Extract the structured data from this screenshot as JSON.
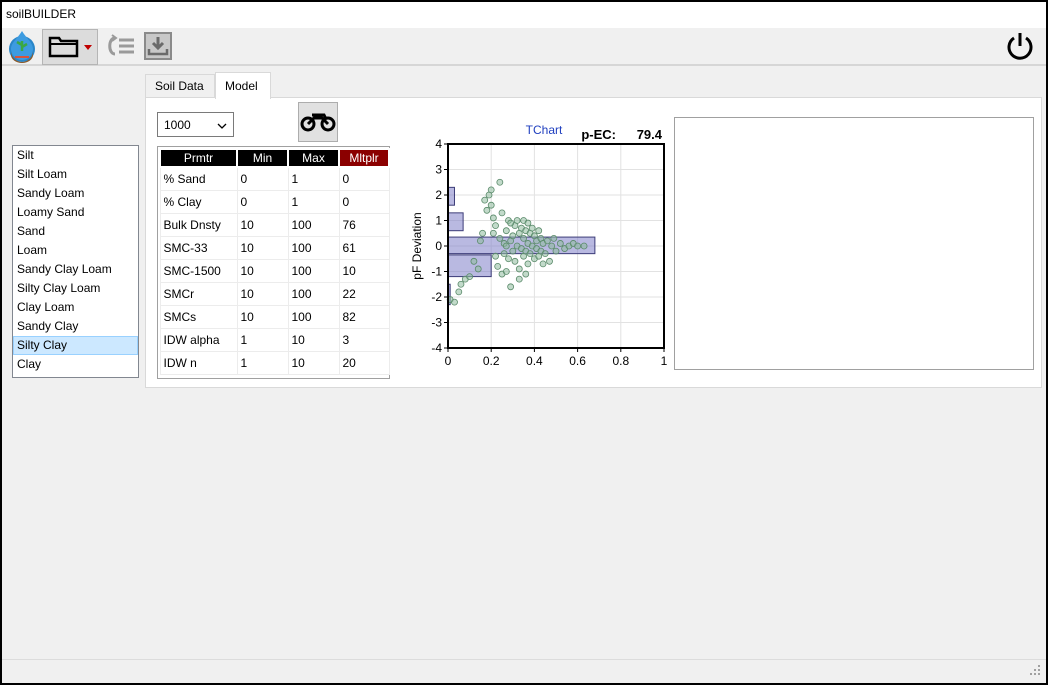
{
  "window": {
    "title": "soilBUILDER"
  },
  "toolbar": {
    "logo_icon": "soilbuilder-logo-icon",
    "open_icon": "folder-icon",
    "undo_icon": "undo-list-icon",
    "save_icon": "save-download-icon",
    "power_icon": "power-icon"
  },
  "soil_list": {
    "items": [
      "Silt",
      "Silt Loam",
      "Sandy Loam",
      "Loamy Sand",
      "Sand",
      "Loam",
      "Sandy Clay Loam",
      "Silty Clay Loam",
      "Clay Loam",
      "Sandy Clay",
      "Silty Clay",
      "Clay"
    ],
    "selected": "Silty Clay"
  },
  "tabs": [
    {
      "label": "Soil Data",
      "active": false
    },
    {
      "label": "Model",
      "active": true
    }
  ],
  "model": {
    "iterations_value": "1000",
    "run_icon": "motorcycle-icon",
    "grid": {
      "headers": [
        "Prmtr",
        "Min",
        "Max",
        "Mltplr"
      ],
      "rows": [
        [
          "% Sand",
          "0",
          "1",
          "0"
        ],
        [
          "% Clay",
          "0",
          "1",
          "0"
        ],
        [
          "Bulk Dnsty",
          "10",
          "100",
          "76"
        ],
        [
          "SMC-33",
          "10",
          "100",
          "61"
        ],
        [
          "SMC-1500",
          "10",
          "100",
          "10"
        ],
        [
          "SMCr",
          "10",
          "100",
          "22"
        ],
        [
          "SMCs",
          "10",
          "100",
          "82"
        ],
        [
          "IDW alpha",
          "1",
          "10",
          "3"
        ],
        [
          "IDW n",
          "1",
          "10",
          "20"
        ]
      ]
    }
  },
  "chart_data": {
    "type": "scatter",
    "title": "TChart",
    "annotation_label": "p-EC:",
    "annotation_value": "79.4",
    "xlabel": "",
    "ylabel": "pF Deviation",
    "xlim": [
      0,
      1
    ],
    "ylim": [
      -4,
      4
    ],
    "x_ticks": [
      "0",
      "0.2",
      "0.4",
      "0.6",
      "0.8",
      "1"
    ],
    "y_ticks": [
      "4",
      "3",
      "2",
      "1",
      "0",
      "-1",
      "-2",
      "-3",
      "-4"
    ],
    "grid": true,
    "colors": {
      "points": "#8fbc9f",
      "bars": "#8080c8",
      "title": "#1f3fbf"
    },
    "histogram": [
      {
        "y_from": 1.6,
        "y_to": 2.3,
        "value": 0.03
      },
      {
        "y_from": 0.6,
        "y_to": 1.3,
        "value": 0.07
      },
      {
        "y_from": -0.3,
        "y_to": 0.35,
        "value": 0.68
      },
      {
        "y_from": -1.2,
        "y_to": -0.35,
        "value": 0.2
      },
      {
        "y_from": -2.3,
        "y_to": -1.5,
        "value": 0.01
      }
    ],
    "points": [
      [
        0.01,
        -2.1
      ],
      [
        0.03,
        -2.2
      ],
      [
        0.05,
        -1.8
      ],
      [
        0.06,
        -1.5
      ],
      [
        0.08,
        -1.3
      ],
      [
        0.1,
        -1.2
      ],
      [
        0.12,
        -0.6
      ],
      [
        0.14,
        -0.9
      ],
      [
        0.15,
        0.2
      ],
      [
        0.16,
        0.5
      ],
      [
        0.17,
        1.8
      ],
      [
        0.18,
        1.4
      ],
      [
        0.19,
        2.0
      ],
      [
        0.2,
        1.6
      ],
      [
        0.2,
        2.2
      ],
      [
        0.21,
        1.1
      ],
      [
        0.22,
        0.8
      ],
      [
        0.22,
        -0.4
      ],
      [
        0.23,
        -0.8
      ],
      [
        0.24,
        0.3
      ],
      [
        0.25,
        1.3
      ],
      [
        0.25,
        -1.1
      ],
      [
        0.26,
        0.1
      ],
      [
        0.26,
        -0.3
      ],
      [
        0.27,
        0.6
      ],
      [
        0.27,
        -1.0
      ],
      [
        0.28,
        1.0
      ],
      [
        0.28,
        -0.5
      ],
      [
        0.29,
        0.2
      ],
      [
        0.29,
        -1.6
      ],
      [
        0.3,
        0.4
      ],
      [
        0.3,
        -0.2
      ],
      [
        0.31,
        0.8
      ],
      [
        0.31,
        -0.6
      ],
      [
        0.32,
        1.0
      ],
      [
        0.32,
        0.0
      ],
      [
        0.33,
        0.5
      ],
      [
        0.33,
        -0.9
      ],
      [
        0.34,
        0.7
      ],
      [
        0.34,
        -0.1
      ],
      [
        0.35,
        1.0
      ],
      [
        0.35,
        0.3
      ],
      [
        0.35,
        -0.4
      ],
      [
        0.36,
        0.6
      ],
      [
        0.36,
        -0.2
      ],
      [
        0.37,
        0.9
      ],
      [
        0.37,
        0.1
      ],
      [
        0.37,
        -0.7
      ],
      [
        0.38,
        0.5
      ],
      [
        0.38,
        -0.3
      ],
      [
        0.39,
        0.7
      ],
      [
        0.39,
        0.0
      ],
      [
        0.4,
        0.4
      ],
      [
        0.4,
        -0.5
      ],
      [
        0.41,
        0.2
      ],
      [
        0.41,
        -0.1
      ],
      [
        0.42,
        0.6
      ],
      [
        0.42,
        -0.4
      ],
      [
        0.43,
        0.3
      ],
      [
        0.43,
        -0.2
      ],
      [
        0.44,
        0.1
      ],
      [
        0.45,
        -0.3
      ],
      [
        0.46,
        0.2
      ],
      [
        0.47,
        -0.6
      ],
      [
        0.48,
        0.0
      ],
      [
        0.5,
        -0.2
      ],
      [
        0.52,
        0.1
      ],
      [
        0.54,
        -0.1
      ],
      [
        0.56,
        0.0
      ],
      [
        0.58,
        0.1
      ],
      [
        0.6,
        0.0
      ],
      [
        0.63,
        0.0
      ],
      [
        0.24,
        2.5
      ],
      [
        0.21,
        0.5
      ],
      [
        0.29,
        0.9
      ],
      [
        0.33,
        -1.3
      ],
      [
        0.44,
        -0.7
      ],
      [
        0.49,
        0.3
      ],
      [
        0.36,
        -1.1
      ],
      [
        0.27,
        0.0
      ]
    ]
  }
}
